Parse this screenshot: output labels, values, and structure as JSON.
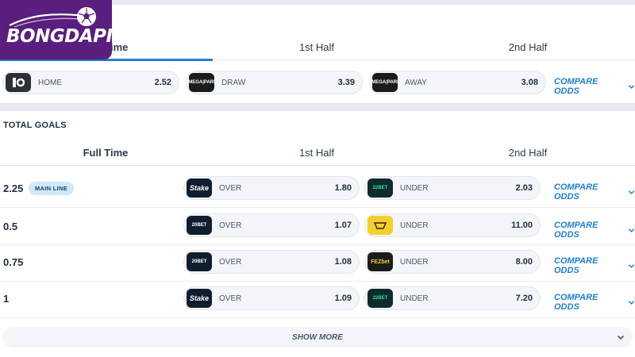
{
  "logo": {
    "text": "BONGDAPI"
  },
  "match_result": {
    "tabs": [
      "Full Time",
      "1st Half",
      "2nd Half"
    ],
    "active_tab": 0,
    "odds": [
      {
        "bookmaker": "bk-icon",
        "label": "HOME",
        "value": "2.52"
      },
      {
        "bookmaker": "megapari",
        "label": "DRAW",
        "value": "3.39"
      },
      {
        "bookmaker": "megapari",
        "label": "AWAY",
        "value": "3.08"
      }
    ],
    "compare": "COMPARE ODDS"
  },
  "total_goals": {
    "title": "TOTAL GOALS",
    "tabs": [
      "Full Time",
      "1st Half",
      "2nd Half"
    ],
    "active_tab": 0,
    "main_line_badge": "MAIN LINE",
    "rows": [
      {
        "line": "2.25",
        "over_bk": "Stake",
        "over_label": "OVER",
        "over": "1.80",
        "under_bk": "22BET",
        "under_label": "UNDER",
        "under": "2.03",
        "compare": "COMPARE ODDS"
      },
      {
        "line": "0.5",
        "over_bk": "20BET",
        "over_label": "OVER",
        "over": "1.07",
        "under_bk": "yellow",
        "under_label": "UNDER",
        "under": "11.00",
        "compare": "COMPARE ODDS"
      },
      {
        "line": "0.75",
        "over_bk": "20BET",
        "over_label": "OVER",
        "over": "1.08",
        "under_bk": "FEZbet",
        "under_label": "UNDER",
        "under": "8.00",
        "compare": "COMPARE ODDS"
      },
      {
        "line": "1",
        "over_bk": "Stake",
        "over_label": "OVER",
        "over": "1.09",
        "under_bk": "22BET",
        "under_label": "UNDER",
        "under": "7.20",
        "compare": "COMPARE ODDS"
      }
    ],
    "show_more": "SHOW MORE"
  },
  "colors": {
    "accent": "#1f7fd1",
    "logo_bg": "#5a1e7e",
    "badge_bg": "#cfe8fb"
  }
}
